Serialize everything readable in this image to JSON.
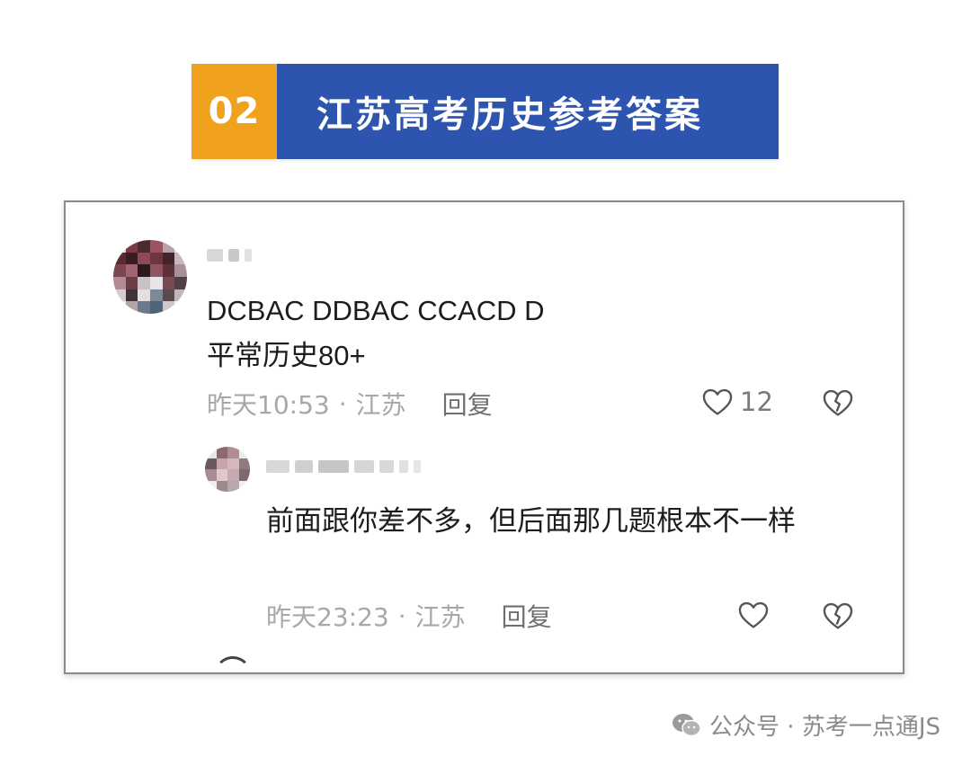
{
  "banner": {
    "number": "02",
    "title": "江苏高考历史参考答案"
  },
  "comment": {
    "lines": [
      "DCBAC DDBAC CCACD D",
      "平常历史80+"
    ],
    "time": "昨天10:53",
    "separator": "·",
    "location": "江苏",
    "reply_label": "回复",
    "like_count": "12"
  },
  "reply": {
    "text": "前面跟你差不多，但后面那几题根本不一样",
    "time": "昨天23:23",
    "separator": "·",
    "location": "江苏",
    "reply_label": "回复"
  },
  "footer": {
    "text": "公众号 · 苏考一点通JS"
  },
  "colors": {
    "accent_orange": "#f0a21e",
    "accent_blue": "#2d55b0"
  },
  "icons": [
    "heart-icon",
    "broken-heart-icon",
    "wechat-icon"
  ]
}
